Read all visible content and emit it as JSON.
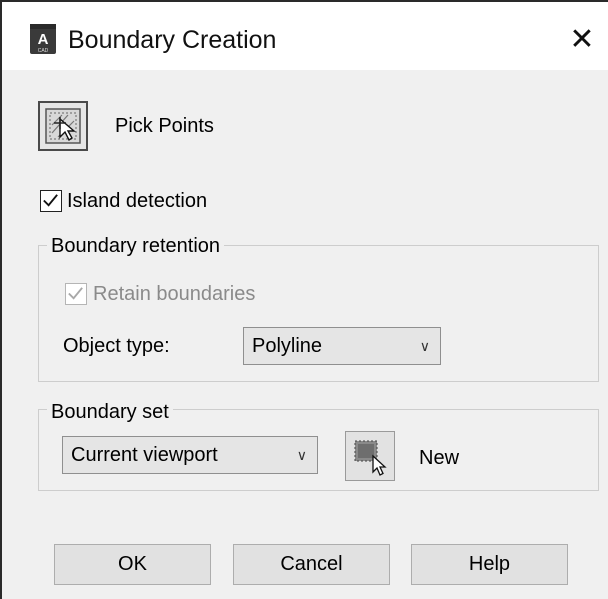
{
  "window": {
    "title": "Boundary Creation",
    "app_icon": "autocad-icon",
    "close_glyph": "✕"
  },
  "pick_points": {
    "label": "Pick Points",
    "icon": "pick-points-icon"
  },
  "island_detection": {
    "label": "Island detection",
    "checked": true
  },
  "boundary_retention": {
    "title": "Boundary retention",
    "retain_boundaries": {
      "label": "Retain boundaries",
      "checked": true,
      "enabled": false
    },
    "object_type": {
      "label": "Object type:",
      "value": "Polyline"
    }
  },
  "boundary_set": {
    "title": "Boundary set",
    "selection": "Current viewport",
    "new_label": "New"
  },
  "buttons": {
    "ok": "OK",
    "cancel": "Cancel",
    "help": "Help"
  }
}
